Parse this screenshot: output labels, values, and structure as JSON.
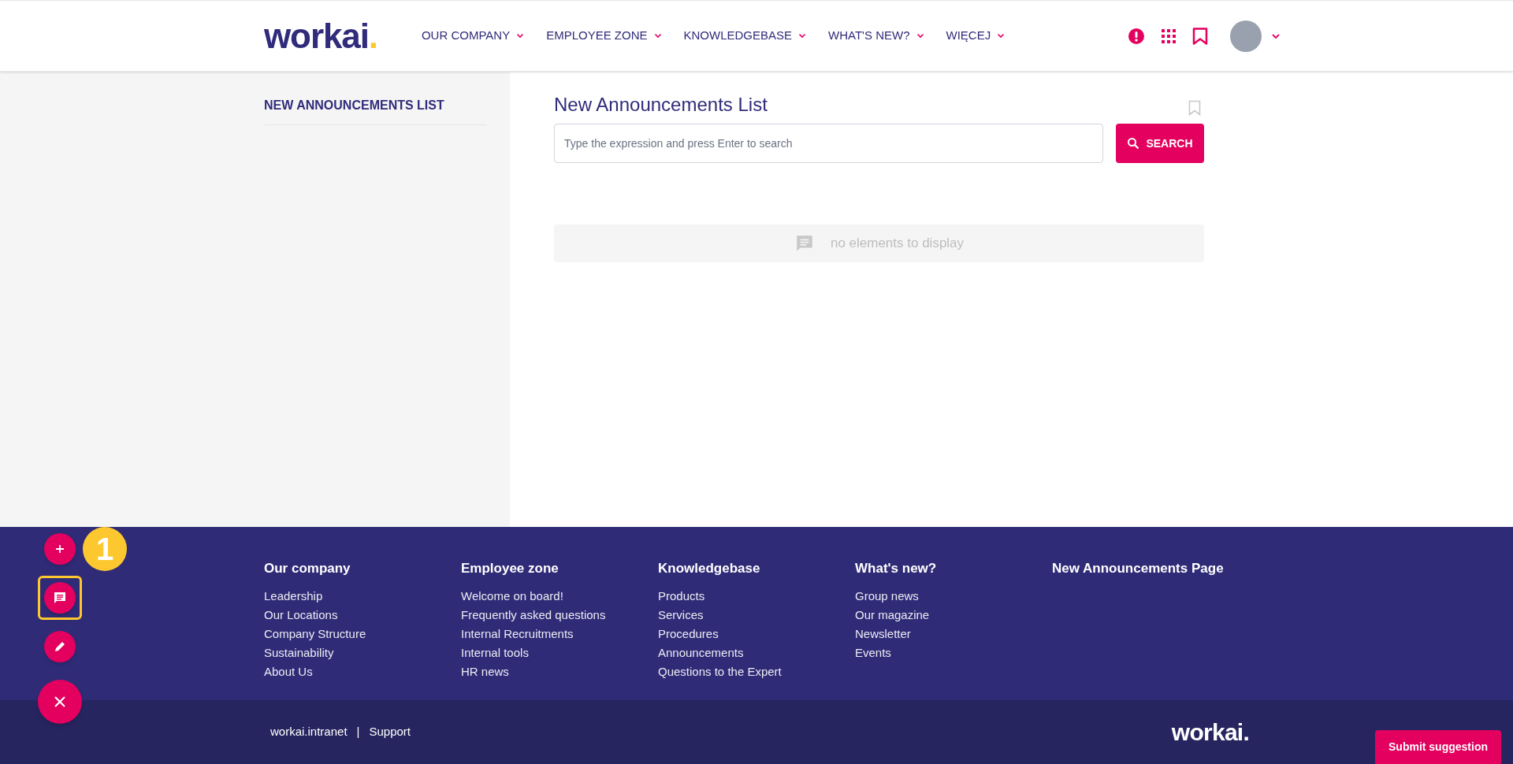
{
  "header": {
    "logo": "workai.",
    "nav": [
      {
        "label": "OUR COMPANY"
      },
      {
        "label": "EMPLOYEE ZONE"
      },
      {
        "label": "KNOWLEDGEBASE"
      },
      {
        "label": "WHAT'S NEW?"
      },
      {
        "label": "WIĘCEJ"
      }
    ]
  },
  "sidebar": {
    "title": "NEW ANNOUNCEMENTS LIST"
  },
  "main": {
    "title": "New Announcements List",
    "search": {
      "placeholder": "Type the expression and press Enter to search",
      "button": "SEARCH"
    },
    "empty_message": "no elements to display"
  },
  "footer": {
    "columns": [
      {
        "heading": "Our company",
        "links": [
          "Leadership",
          "Our Locations",
          "Company Structure",
          "Sustainability",
          "About Us"
        ]
      },
      {
        "heading": "Employee zone",
        "links": [
          "Welcome on board!",
          "Frequently asked questions",
          "Internal Recruitments",
          "Internal tools",
          "HR news"
        ]
      },
      {
        "heading": "Knowledgebase",
        "links": [
          "Products",
          "Services",
          "Procedures",
          "Announcements",
          "Questions to the Expert"
        ]
      },
      {
        "heading": "What's new?",
        "links": [
          "Group news",
          "Our magazine",
          "Newsletter",
          "Events"
        ]
      },
      {
        "heading": "New Announcements Page"
      }
    ],
    "bottom_links": [
      "workai.intranet",
      "Support"
    ],
    "separator": "|",
    "logo": "workai."
  },
  "fab_menu": {
    "badge": "1",
    "buttons": [
      {
        "kind": "add",
        "highlighted": false
      },
      {
        "kind": "chat",
        "highlighted": true
      },
      {
        "kind": "edit",
        "highlighted": false
      },
      {
        "kind": "close",
        "highlighted": false
      }
    ]
  },
  "submit_button": "Submit suggestion"
}
